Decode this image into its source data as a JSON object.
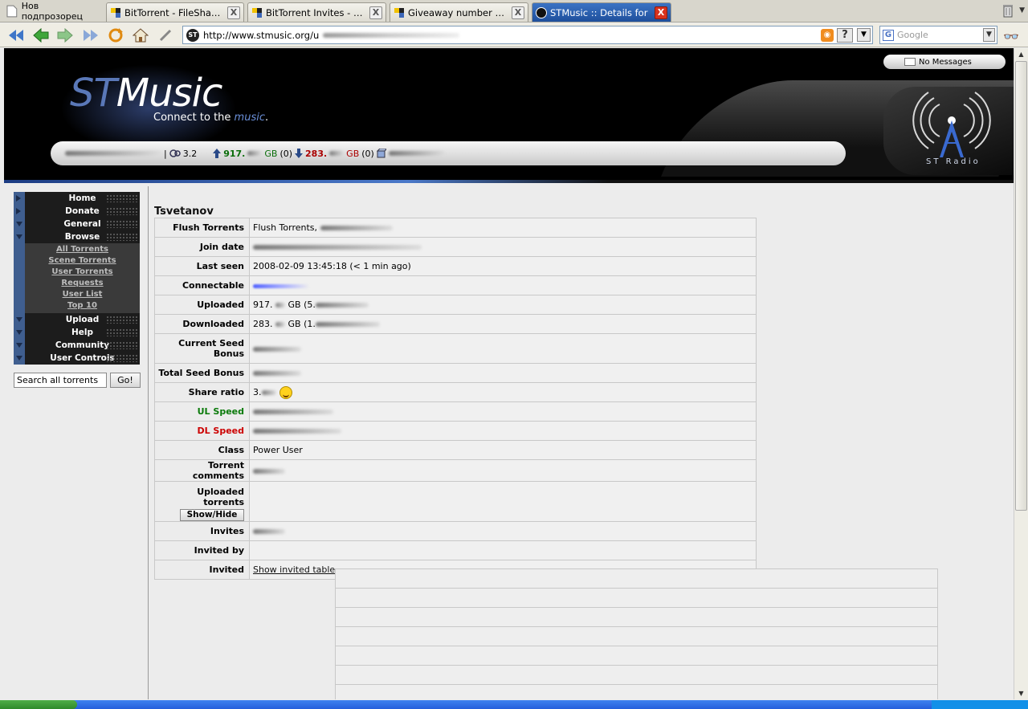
{
  "browser": {
    "new_tab_label": "Нов подпрозорец",
    "tabs": [
      {
        "label": "BitTorrent - FileSharing Talk",
        "active": false
      },
      {
        "label": "BitTorrent Invites - FileS...",
        "active": false
      },
      {
        "label": "Giveaway number 7 - Fil...",
        "active": false
      },
      {
        "label": "STMusic :: Details for",
        "active": true
      }
    ],
    "close_glyph": "X",
    "url": "http://www.stmusic.org/u",
    "url_favicon": "ST",
    "search_engine": "Google",
    "search_placeholder": "Google",
    "rss_glyph": "◉",
    "help_glyph": "?"
  },
  "site": {
    "logo_st": "ST",
    "logo_music": "Music",
    "tagline_pre": "Connect to the ",
    "tagline_hl": "music",
    "tagline_post": ".",
    "messages": "No Messages",
    "stats": {
      "ratio": "3.2",
      "uploaded": "917.",
      "uploaded_unit": "GB",
      "uploaded_count": "(0)",
      "downloaded": "283.",
      "downloaded_unit": "GB",
      "downloaded_count": "(0)",
      "separator": "|"
    },
    "radio_label": "ST Radio"
  },
  "nav": {
    "home": "Home",
    "donate": "Donate",
    "general": "General",
    "browse": "Browse",
    "browse_sub": [
      "All Torrents",
      "Scene Torrents",
      "User Torrents",
      "Requests",
      "User List",
      "Top 10"
    ],
    "upload": "Upload",
    "help": "Help",
    "community": "Community",
    "user_controls": "User Controls",
    "search_placeholder": "Search all torrents",
    "search_value": "Search all torrents",
    "go_label": "Go!"
  },
  "profile": {
    "username": "Tsvetanov",
    "rows": {
      "flush_label": "Flush Torrents",
      "flush_value": "Flush Torrents,",
      "join_label": "Join date",
      "last_seen_label": "Last seen",
      "last_seen_value": "2008-02-09 13:45:18 (< 1 min ago)",
      "connectable_label": "Connectable",
      "uploaded_label": "Uploaded",
      "uploaded_value": "917.",
      "uploaded_unit": "GB (5.",
      "downloaded_label": "Downloaded",
      "downloaded_value": "283.",
      "downloaded_unit": "GB (1.",
      "cur_bonus_label": "Current Seed Bonus",
      "total_bonus_label": "Total Seed Bonus",
      "ratio_label": "Share ratio",
      "ratio_value": "3.",
      "ul_speed_label": "UL Speed",
      "dl_speed_label": "DL Speed",
      "class_label": "Class",
      "class_value": "Power User",
      "comments_label": "Torrent comments",
      "uploaded_torrents_label": "Uploaded torrents",
      "showhide_label": "Show/Hide",
      "invites_label": "Invites",
      "invited_by_label": "Invited by",
      "invited_label": "Invited",
      "invited_link": "Show invited table"
    }
  },
  "colors": {
    "accent_blue": "#3f5e8f",
    "ul_green": "#0a7a0a",
    "dl_red": "#cc0000",
    "active_tab": "#2a5fb0"
  }
}
